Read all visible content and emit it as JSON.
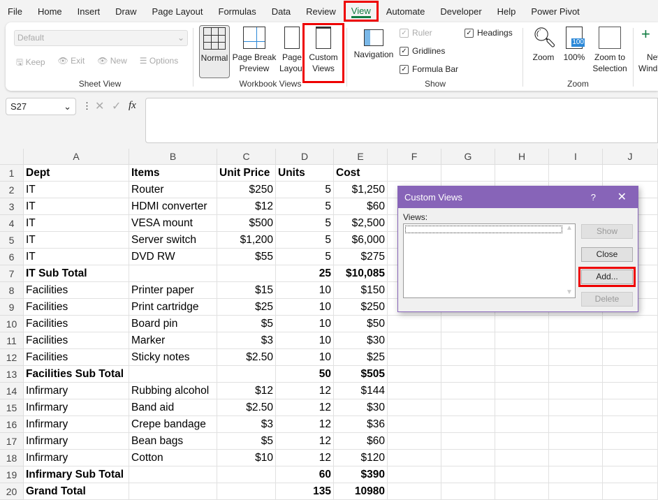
{
  "tabs": [
    "File",
    "Home",
    "Insert",
    "Draw",
    "Page Layout",
    "Formulas",
    "Data",
    "Review",
    "View",
    "Automate",
    "Developer",
    "Help",
    "Power Pivot"
  ],
  "active_tab": "View",
  "ribbon": {
    "sheet_view": {
      "dropdown": "Default",
      "keep": "Keep",
      "exit": "Exit",
      "new": "New",
      "options": "Options",
      "label": "Sheet View"
    },
    "workbook_views": {
      "normal": "Normal",
      "page_break": [
        "Page Break",
        "Preview"
      ],
      "page_layout": [
        "Page",
        "Layout"
      ],
      "custom_views": [
        "Custom",
        "Views"
      ],
      "label": "Workbook Views"
    },
    "show": {
      "navigation": "Navigation",
      "ruler": "Ruler",
      "gridlines": "Gridlines",
      "formula_bar": "Formula Bar",
      "headings": "Headings",
      "label": "Show",
      "ruler_checked": true,
      "gridlines_checked": true,
      "formula_bar_checked": true,
      "headings_checked": true
    },
    "zoom": {
      "zoom": "Zoom",
      "hundred": "100%",
      "icon_text": "100",
      "zoom_sel": [
        "Zoom to",
        "Selection"
      ],
      "label": "Zoom"
    },
    "window": {
      "new_window": [
        "New",
        "Wind"
      ]
    }
  },
  "formula_bar": {
    "name_box": "S27",
    "fx": "fx",
    "value": ""
  },
  "columns": [
    "A",
    "B",
    "C",
    "D",
    "E",
    "F",
    "G",
    "H",
    "I",
    "J"
  ],
  "rows": [
    [
      "Dept",
      "Items",
      "Unit Price",
      "Units",
      "Cost"
    ],
    [
      "IT",
      "Router",
      "$250",
      "5",
      "$1,250"
    ],
    [
      "IT",
      "HDMI converter",
      "$12",
      "5",
      "$60"
    ],
    [
      "IT",
      "VESA mount",
      "$500",
      "5",
      "$2,500"
    ],
    [
      "IT",
      "Server switch",
      "$1,200",
      "5",
      "$6,000"
    ],
    [
      "IT",
      "DVD RW",
      "$55",
      "5",
      "$275"
    ],
    [
      "IT Sub Total",
      "",
      "",
      "25",
      "$10,085"
    ],
    [
      "Facilities",
      "Printer paper",
      "$15",
      "10",
      "$150"
    ],
    [
      "Facilities",
      "Print cartridge",
      "$25",
      "10",
      "$250"
    ],
    [
      "Facilities",
      "Board pin",
      "$5",
      "10",
      "$50"
    ],
    [
      "Facilities",
      "Marker",
      "$3",
      "10",
      "$30"
    ],
    [
      "Facilities",
      "Sticky notes",
      "$2.50",
      "10",
      "$25"
    ],
    [
      "Facilities Sub Total",
      "",
      "",
      "50",
      "$505"
    ],
    [
      "Infirmary",
      "Rubbing alcohol",
      "$12",
      "12",
      "$144"
    ],
    [
      "Infirmary",
      "Band aid",
      "$2.50",
      "12",
      "$30"
    ],
    [
      "Infirmary",
      "Crepe bandage",
      "$3",
      "12",
      "$36"
    ],
    [
      "Infirmary",
      "Bean bags",
      "$5",
      "12",
      "$60"
    ],
    [
      "Infirmary",
      "Cotton",
      "$10",
      "12",
      "$120"
    ],
    [
      "Infirmary Sub Total",
      "",
      "",
      "60",
      "$390"
    ],
    [
      "Grand Total",
      "",
      "",
      "135",
      "10980"
    ]
  ],
  "dialog": {
    "title": "Custom Views",
    "help": "?",
    "close_x": "✕",
    "views_label": "Views:",
    "show": "Show",
    "close": "Close",
    "add": "Add...",
    "delete": "Delete"
  },
  "colors": {
    "accent": "#107c41",
    "dialog": "#8764b8",
    "highlight": "#e00000"
  }
}
